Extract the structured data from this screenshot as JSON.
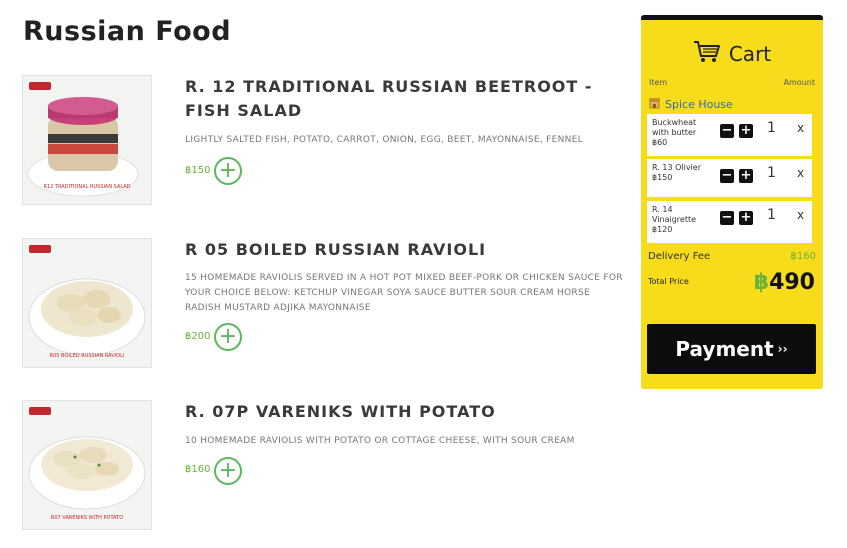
{
  "page_title": "Russian Food",
  "menu": [
    {
      "name": "R. 12 TRADITIONAL RUSSIAN BEETROOT - FISH SALAD",
      "description": "LIGHTLY SALTED FISH, POTATO, CARROT, ONION, EGG, BEET, MAYONNAISE, FENNEL",
      "price": "฿150",
      "image": "beetroot-salad"
    },
    {
      "name": "R 05 BOILED RUSSIAN RAVIOLI",
      "description": "15 HOMEMADE RAVIOLIS SERVED IN A HOT POT MIXED BEEF-PORK OR CHICKEN SAUCE FOR YOUR CHOICE BELOW: KETCHUP VINEGAR SOYA SAUCE BUTTER SOUR CREAM HORSE RADISH MUSTARD ADJIKA MAYONNAISE",
      "price": "฿200",
      "image": "ravioli-bowl"
    },
    {
      "name": "R. 07P VARENIKS WITH POTATO",
      "description": "10 HOMEMADE RAVIOLIS WITH POTATO OR COTTAGE CHEESE, WITH SOUR CREAM",
      "price": "฿160",
      "image": "vareniki-bowl"
    }
  ],
  "cart": {
    "title": "Cart",
    "col_item": "Item",
    "col_amount": "Amount",
    "store": "Spice House",
    "lines": [
      {
        "name": "Buckwheat with butter",
        "price": "฿60",
        "qty": "1"
      },
      {
        "name": "R. 13 Olivier",
        "price": "฿150",
        "qty": "1"
      },
      {
        "name": "R. 14 Vinaigrette",
        "price": "฿120",
        "qty": "1"
      }
    ],
    "delivery_label": "Delivery Fee",
    "delivery_value": "฿160",
    "total_label": "Total Price",
    "total_currency": "฿",
    "total_amount": "490",
    "pay_label": "Payment",
    "pay_chevron": "››",
    "minus": "−",
    "plus": "+",
    "remove": "x"
  },
  "colors": {
    "accent_yellow": "#f7dc1b",
    "green": "#5cb85c",
    "price_green": "#6bb13a"
  },
  "icons": [
    "cart-icon",
    "store-icon",
    "plus-icon",
    "minus-icon",
    "close-icon"
  ]
}
